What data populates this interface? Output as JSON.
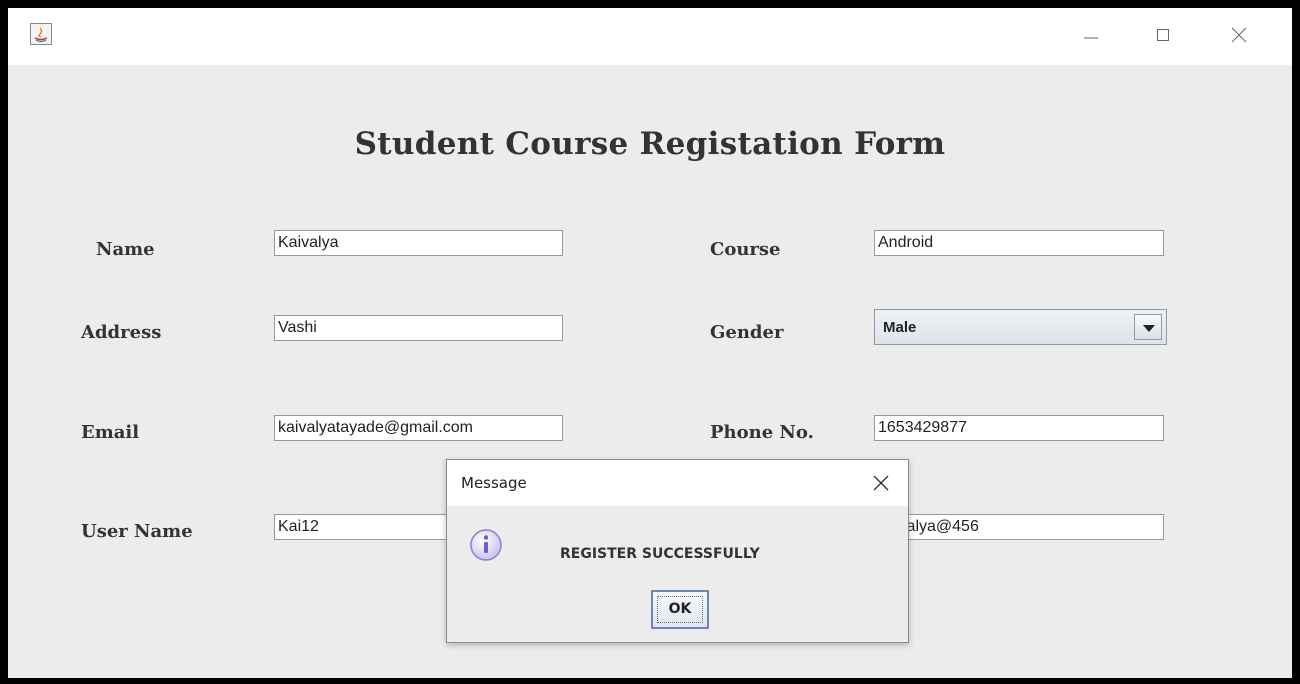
{
  "window": {
    "icon": "java-app-icon",
    "controls": [
      "minimize-icon",
      "maximize-icon",
      "close-icon"
    ]
  },
  "form": {
    "title": "Student Course Registation Form",
    "fields": {
      "name": {
        "label": "Name",
        "value": "Kaivalya"
      },
      "address": {
        "label": "Address",
        "value": "Vashi"
      },
      "email": {
        "label": "Email",
        "value": "kaivalyatayade@gmail.com"
      },
      "username": {
        "label": "User Name",
        "value": "Kai12"
      },
      "course": {
        "label": "Course",
        "value": "Android"
      },
      "gender": {
        "label": "Gender",
        "value": "Male"
      },
      "phone": {
        "label": "Phone No.",
        "value": "1653429877"
      },
      "password": {
        "value": "ivalya@456"
      }
    }
  },
  "dialog": {
    "title": "Message",
    "message": "REGISTER SUCCESSFULLY",
    "ok_label": "OK",
    "icon": "info-icon"
  },
  "colors": {
    "window_bg": "#ececec",
    "titlebar_bg": "#ffffff",
    "border": "#000000",
    "field_border": "#8e9aa8",
    "info_icon": "#8a7fd6"
  }
}
